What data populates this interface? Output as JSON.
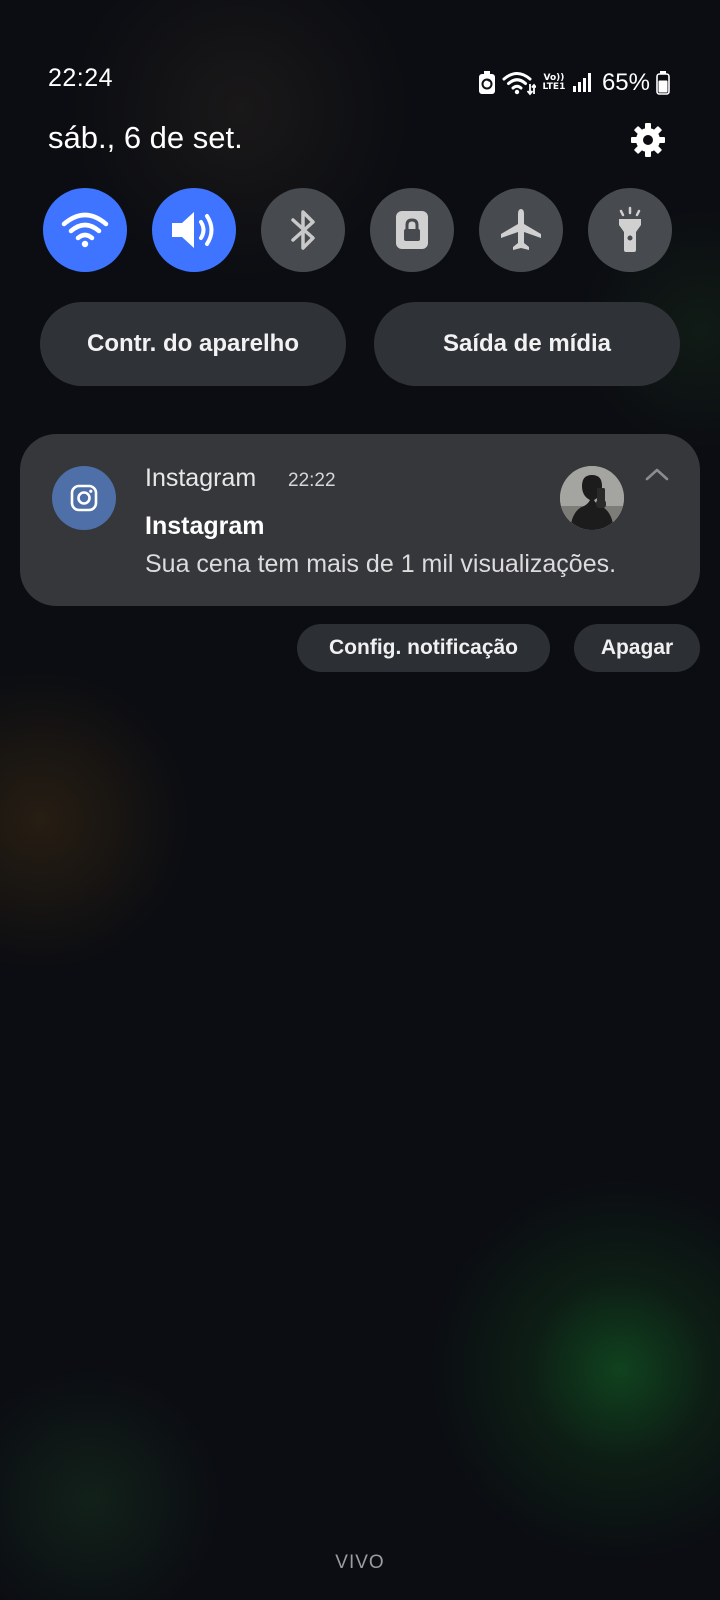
{
  "status_bar": {
    "time": "22:24",
    "network_badge_top": "Vo))",
    "network_badge_bottom": "LTE1",
    "battery": "65%",
    "icons": [
      "battery-saver-icon",
      "wifi-icon",
      "volte-icon",
      "signal-icon",
      "battery-icon"
    ]
  },
  "header": {
    "date": "sáb., 6 de set.",
    "settings_icon": "gear-icon"
  },
  "quick_toggles": [
    {
      "name": "wifi",
      "icon": "wifi-icon",
      "on": true
    },
    {
      "name": "sound",
      "icon": "speaker-icon",
      "on": true
    },
    {
      "name": "bluetooth",
      "icon": "bluetooth-icon",
      "on": false
    },
    {
      "name": "rotation-lock",
      "icon": "lock-icon",
      "on": false
    },
    {
      "name": "airplane-mode",
      "icon": "airplane-icon",
      "on": false
    },
    {
      "name": "flashlight",
      "icon": "flashlight-icon",
      "on": false
    }
  ],
  "buttons": {
    "device_control": "Contr. do aparelho",
    "media_output": "Saída de mídia"
  },
  "notification": {
    "app_name": "Instagram",
    "time": "22:22",
    "title": "Instagram",
    "text": "Sua cena tem mais de 1 mil visualizações.",
    "icon": "instagram-icon",
    "avatar": "profile-avatar"
  },
  "notification_actions": {
    "settings": "Config. notificação",
    "clear": "Apagar"
  },
  "carrier": "VIVO",
  "colors": {
    "toggle_on": "#3e74ff",
    "toggle_off": "#474a4f",
    "card": "#35373b",
    "app_icon_bg": "#4e6fa8"
  }
}
